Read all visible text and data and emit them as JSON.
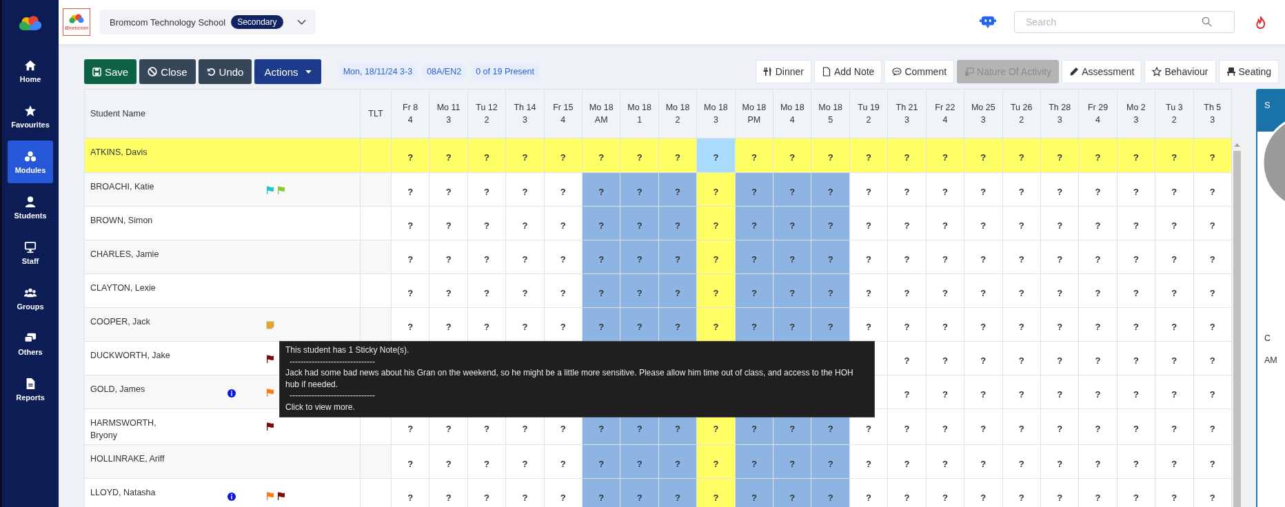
{
  "sidebar": {
    "items": [
      {
        "label": "Home",
        "selected": false
      },
      {
        "label": "Favourites",
        "selected": false
      },
      {
        "label": "Modules",
        "selected": true
      },
      {
        "label": "Students",
        "selected": false
      },
      {
        "label": "Staff",
        "selected": false
      },
      {
        "label": "Groups",
        "selected": false
      },
      {
        "label": "Others",
        "selected": false
      },
      {
        "label": "Reports",
        "selected": false
      }
    ]
  },
  "header": {
    "logo_text": "Bromcom",
    "school": "Bromcom Technology School",
    "phase": "Secondary",
    "search": {
      "placeholder": "Search"
    }
  },
  "toolbar": {
    "buttons": [
      {
        "label": "Save",
        "kind": "save"
      },
      {
        "label": "Close",
        "kind": "close"
      },
      {
        "label": "Undo",
        "kind": "undo"
      },
      {
        "label": "Actions",
        "kind": "menu"
      }
    ],
    "pills": [
      "Mon, 18/11/24 3-3",
      "08A/EN2",
      "0 of 19 Present"
    ],
    "actions": [
      {
        "label": "Dinner",
        "disabled": false
      },
      {
        "label": "Add Note",
        "disabled": false
      },
      {
        "label": "Comment",
        "disabled": false
      },
      {
        "label": "Nature Of Activity",
        "disabled": true
      },
      {
        "label": "Assessment",
        "disabled": false
      },
      {
        "label": "Behaviour",
        "disabled": false
      },
      {
        "label": "Seating",
        "disabled": false
      }
    ]
  },
  "table": {
    "name_header": "Student Name",
    "tlt_header": "TLT",
    "columns": [
      {
        "day": "Fr 8",
        "period": "4",
        "kind": "plain"
      },
      {
        "day": "Mo 11",
        "period": "3",
        "kind": "plain"
      },
      {
        "day": "Tu 12",
        "period": "2",
        "kind": "plain"
      },
      {
        "day": "Th 14",
        "period": "3",
        "kind": "plain"
      },
      {
        "day": "Fr 15",
        "period": "4",
        "kind": "plain"
      },
      {
        "day": "Mo 18",
        "period": "AM",
        "kind": "today"
      },
      {
        "day": "Mo 18",
        "period": "1",
        "kind": "today"
      },
      {
        "day": "Mo 18",
        "period": "2",
        "kind": "today"
      },
      {
        "day": "Mo 18",
        "period": "3",
        "kind": "current"
      },
      {
        "day": "Mo 18",
        "period": "PM",
        "kind": "today"
      },
      {
        "day": "Mo 18",
        "period": "4",
        "kind": "today"
      },
      {
        "day": "Mo 18",
        "period": "5",
        "kind": "today"
      },
      {
        "day": "Tu 19",
        "period": "2",
        "kind": "plain"
      },
      {
        "day": "Th 21",
        "period": "3",
        "kind": "plain"
      },
      {
        "day": "Fr 22",
        "period": "4",
        "kind": "plain"
      },
      {
        "day": "Mo 25",
        "period": "3",
        "kind": "plain"
      },
      {
        "day": "Tu 26",
        "period": "2",
        "kind": "plain"
      },
      {
        "day": "Th 28",
        "period": "3",
        "kind": "plain"
      },
      {
        "day": "Fr 29",
        "period": "4",
        "kind": "plain"
      },
      {
        "day": "Mo 2",
        "period": "3",
        "kind": "plain"
      },
      {
        "day": "Tu 3",
        "period": "2",
        "kind": "plain"
      },
      {
        "day": "Th 5",
        "period": "3",
        "kind": "plain"
      }
    ],
    "rows": [
      {
        "name": "ATKINS, Davis",
        "selected": true,
        "markers": [],
        "marks": [
          "?",
          "?",
          "?",
          "?",
          "?",
          "?",
          "?",
          "?",
          "?",
          "?",
          "?",
          "?",
          "?",
          "?",
          "?",
          "?",
          "?",
          "?",
          "?",
          "?",
          "?",
          "?"
        ]
      },
      {
        "name": "BROACHI, Katie",
        "selected": false,
        "markers": [
          {
            "kind": "flag",
            "color": "#1cc6cc"
          },
          {
            "kind": "flag",
            "color": "#8dcc2e"
          }
        ],
        "marks": [
          "?",
          "?",
          "?",
          "?",
          "?",
          "?",
          "?",
          "?",
          "?",
          "?",
          "?",
          "?",
          "?",
          "?",
          "?",
          "?",
          "?",
          "?",
          "?",
          "?",
          "?",
          "?"
        ]
      },
      {
        "name": "BROWN, Simon",
        "selected": false,
        "markers": [],
        "marks": [
          "?",
          "?",
          "?",
          "?",
          "?",
          "?",
          "?",
          "?",
          "?",
          "?",
          "?",
          "?",
          "?",
          "?",
          "?",
          "?",
          "?",
          "?",
          "?",
          "?",
          "?",
          "?"
        ]
      },
      {
        "name": "CHARLES, Jamie",
        "selected": false,
        "markers": [],
        "marks": [
          "?",
          "?",
          "?",
          "?",
          "?",
          "?",
          "?",
          "?",
          "?",
          "?",
          "?",
          "?",
          "?",
          "?",
          "?",
          "?",
          "?",
          "?",
          "?",
          "?",
          "?",
          "?"
        ]
      },
      {
        "name": "CLAYTON, Lexie",
        "selected": false,
        "markers": [],
        "marks": [
          "?",
          "?",
          "?",
          "?",
          "?",
          "?",
          "?",
          "?",
          "?",
          "?",
          "?",
          "?",
          "?",
          "?",
          "?",
          "?",
          "?",
          "?",
          "?",
          "?",
          "?",
          "?"
        ]
      },
      {
        "name": "COOPER, Jack",
        "selected": false,
        "markers": [
          {
            "kind": "note"
          }
        ],
        "marks": [
          "?",
          "?",
          "?",
          "?",
          "?",
          "?",
          "?",
          "?",
          "?",
          "?",
          "?",
          "?",
          "?",
          "?",
          "?",
          "?",
          "?",
          "?",
          "?",
          "?",
          "?",
          "?"
        ]
      },
      {
        "name": "DUCKWORTH, Jake",
        "selected": false,
        "markers": [
          {
            "kind": "flag",
            "color": "#7a0c0c"
          }
        ],
        "marks": [
          "?",
          "?",
          "?",
          "?",
          "?",
          "?",
          "?",
          "?",
          "?"
        ]
      },
      {
        "name": "GOLD, James",
        "selected": false,
        "markers": [
          {
            "kind": "info"
          },
          {
            "kind": "flag",
            "color": "#ff7a12"
          }
        ],
        "marks": [
          "?",
          "?",
          "?",
          "?",
          "?",
          "?",
          "?",
          "?",
          "?"
        ]
      },
      {
        "name": "HARMSWORTH, Bryony",
        "selected": false,
        "markers": [
          {
            "kind": "flag",
            "color": "#7a0c0c"
          }
        ],
        "marks": [
          "?",
          "?",
          "?",
          "?",
          "?",
          "?",
          "?",
          "?",
          "?",
          "?",
          "?",
          "?",
          "?",
          "?",
          "?",
          "?",
          "?",
          "?",
          "?",
          "?",
          "?",
          "?"
        ]
      },
      {
        "name": "HOLLINRAKE, Ariff",
        "selected": false,
        "markers": [],
        "marks": [
          "?",
          "?",
          "?",
          "?",
          "?",
          "?",
          "?",
          "?",
          "?",
          "?",
          "?",
          "?",
          "?",
          "?",
          "?",
          "?",
          "?",
          "?",
          "?",
          "?",
          "?",
          "?"
        ]
      },
      {
        "name": "LLOYD, Natasha",
        "selected": false,
        "markers": [
          {
            "kind": "info"
          },
          {
            "kind": "flag",
            "color": "#ff7a12"
          },
          {
            "kind": "flag",
            "color": "#7a0c0c"
          }
        ],
        "marks": [
          "?",
          "?",
          "?",
          "?",
          "?",
          "?",
          "?",
          "?",
          "?",
          "?",
          "?",
          "?",
          "?",
          "?",
          "?",
          "?",
          "?",
          "?",
          "?",
          "?",
          "?",
          "?"
        ]
      }
    ]
  },
  "tooltip": {
    "lines": [
      "This student has 1 Sticky Note(s).",
      "-------------------------------",
      "Jack had some bad news about his Gran on the weekend, so he might be a little more sensitive. Please allow him time out of class, and access to the HOH hub if needed.",
      "-------------------------------",
      "Click to view more."
    ]
  },
  "side_panel": {
    "title": "S",
    "lines": [
      "C",
      "AM"
    ]
  }
}
